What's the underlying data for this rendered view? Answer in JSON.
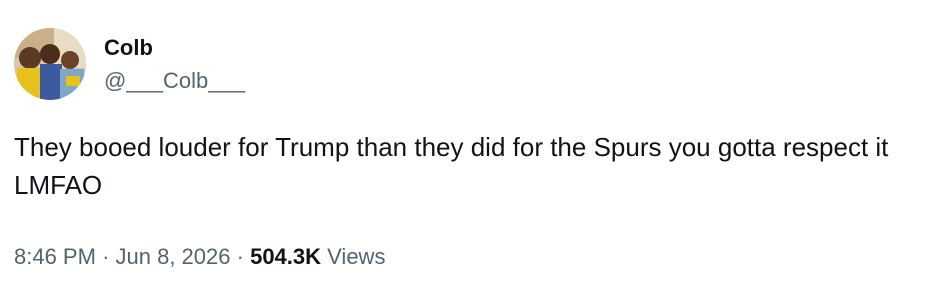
{
  "user": {
    "display_name": "Colb",
    "handle": "@___Colb___",
    "avatar_icon": "avatar-photo"
  },
  "tweet": {
    "text": "They booed louder for Trump than they did for the Spurs you gotta respect it LMFAO",
    "time": "8:46 PM",
    "separator": "·",
    "date": "Jun 8, 2026",
    "views_count": "504.3K",
    "views_label": "Views"
  },
  "colors": {
    "text": "#0f1419",
    "secondary": "#536471",
    "background": "#ffffff"
  }
}
